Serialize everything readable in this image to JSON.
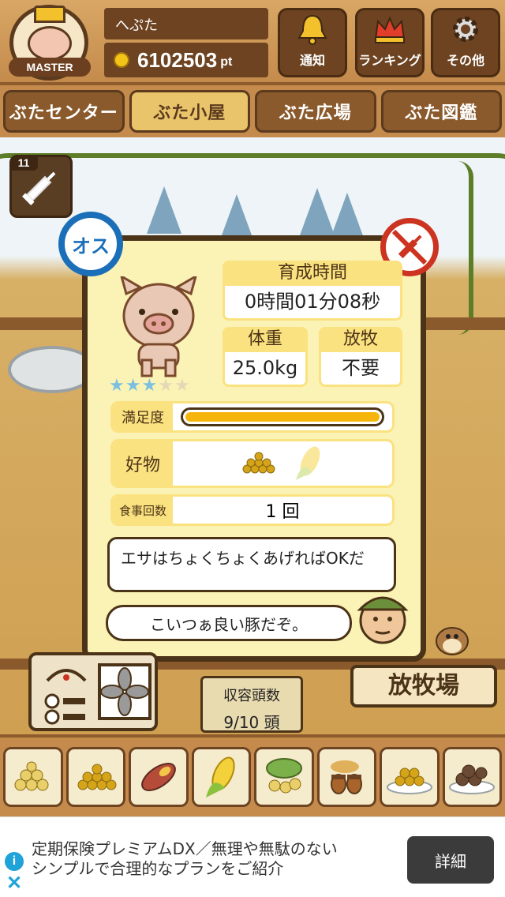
{
  "header": {
    "badge_label": "MASTER",
    "player_name": "へぷた",
    "points": "6102503",
    "points_unit": "pt",
    "buttons": [
      {
        "label": "通知",
        "icon": "bell-icon"
      },
      {
        "label": "ランキング",
        "icon": "crown-icon"
      },
      {
        "label": "その他",
        "icon": "gear-icon"
      }
    ]
  },
  "tabs": [
    {
      "label": "ぶたセンター",
      "active": false
    },
    {
      "label": "ぶた小屋",
      "active": true
    },
    {
      "label": "ぶた広場",
      "active": false
    },
    {
      "label": "ぶた図鑑",
      "active": false
    }
  ],
  "scene": {
    "syringe_count": "11",
    "gender_label": "オス",
    "stars_filled": 3,
    "stars_total": 5
  },
  "pig_status": {
    "growth_time_label": "育成時間",
    "growth_time_value": "0時間01分08秒",
    "weight_label": "体重",
    "weight_value": "25.0kg",
    "grazing_label": "放牧",
    "grazing_value": "不要",
    "satisfaction_label": "満足度",
    "satisfaction_fraction": 1.0,
    "favorite_label": "好物",
    "favorite_foods": [
      "grain-icon",
      "corn-icon"
    ],
    "meals_label": "食事回数",
    "meals_value": "1 回",
    "message_1": "エサはちょくちょくあげればOKだ",
    "message_2": "こいつぁ良い豚だぞ。"
  },
  "controls": {
    "capacity_label": "収容頭数",
    "capacity_value": "9/10 頭",
    "pasture_sign": "放牧場"
  },
  "food_bar": [
    {
      "icon": "soybean-icon"
    },
    {
      "icon": "grain-icon"
    },
    {
      "icon": "sweet-potato-icon"
    },
    {
      "icon": "corn-icon"
    },
    {
      "icon": "vegetable-icon"
    },
    {
      "icon": "acorn-icon"
    },
    {
      "icon": "grain-plate-icon"
    },
    {
      "icon": "meatball-plate-icon"
    }
  ],
  "ad": {
    "text_line1": "定期保険プレミアムDX／無理や無駄のない",
    "text_line2": "シンプルで合理的なプランをご紹介",
    "button_label": "詳細",
    "info_icon": "info-icon",
    "close_icon": "close-icon"
  },
  "colors": {
    "wood": "#c48b4c",
    "dark_wood": "#6d4321",
    "card_bg": "#fbf2b6",
    "label_yellow": "#fbe280",
    "male_blue": "#1a6fb8",
    "prohibit_red": "#cc3320",
    "bar_fill": "#f5b50a"
  }
}
